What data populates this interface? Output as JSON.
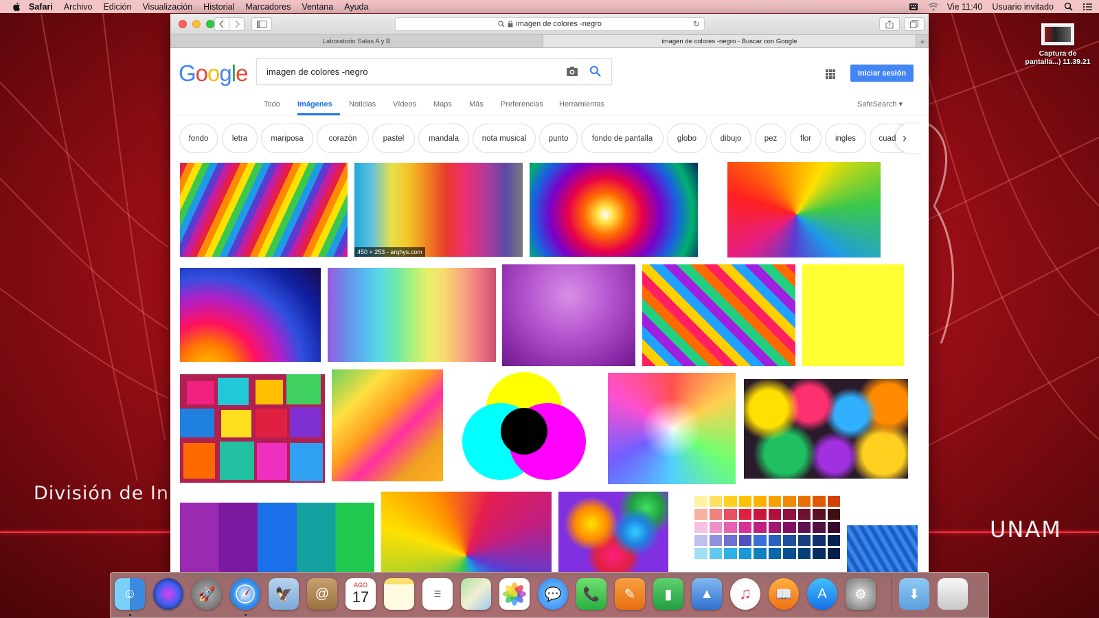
{
  "menubar": {
    "app": "Safari",
    "items": [
      "Archivo",
      "Edición",
      "Visualización",
      "Historial",
      "Marcadores",
      "Ventana",
      "Ayuda"
    ],
    "clock": "Vie 11:40",
    "user": "Usuario invitado"
  },
  "desktop": {
    "file_label_1": "Captura de",
    "file_label_2": "pantalla...) 11.39.21",
    "wallpaper_left": "División de In",
    "wallpaper_right": "UNAM"
  },
  "browser": {
    "url": "imagen de colores -negro",
    "tabs": [
      "Laboratorio Salas A y B",
      "imagen de colores -negro - Buscar con Google"
    ],
    "tab_plus": "+"
  },
  "google": {
    "logo": [
      "G",
      "o",
      "o",
      "g",
      "l",
      "e"
    ],
    "query": "imagen de colores -negro",
    "signin": "Iniciar sesión",
    "nav": [
      "Todo",
      "Imágenes",
      "Noticias",
      "Vídeos",
      "Maps",
      "Más",
      "Preferencias",
      "Herramientas"
    ],
    "safesearch": "SafeSearch ▾",
    "chips": [
      "fondo",
      "letra",
      "mariposa",
      "corazón",
      "pastel",
      "mandala",
      "nota musical",
      "punto",
      "fondo de pantalla",
      "globo",
      "dibujo",
      "pez",
      "flor",
      "ingles",
      "cuadro"
    ],
    "image_caption": "450 × 253 - arqhys.com"
  },
  "colors": {
    "accent": "#1a73e8",
    "signin": "#4285f4",
    "close": "#fc605c",
    "minimize": "#fdbc40",
    "zoom": "#34c84a"
  },
  "dock": [
    "finder-icon",
    "siri-icon",
    "launchpad-icon",
    "safari-icon",
    "mail-icon",
    "contacts-icon",
    "calendar-icon",
    "notes-icon",
    "reminders-icon",
    "maps-icon",
    "photos-icon",
    "messages-icon",
    "facetime-icon",
    "pages-icon",
    "numbers-icon",
    "keynote-icon",
    "itunes-icon",
    "ibooks-icon",
    "appstore-icon",
    "system-preferences-icon",
    "downloads-icon",
    "trash-icon"
  ],
  "calendar": {
    "month": "AGO",
    "day": "17"
  }
}
